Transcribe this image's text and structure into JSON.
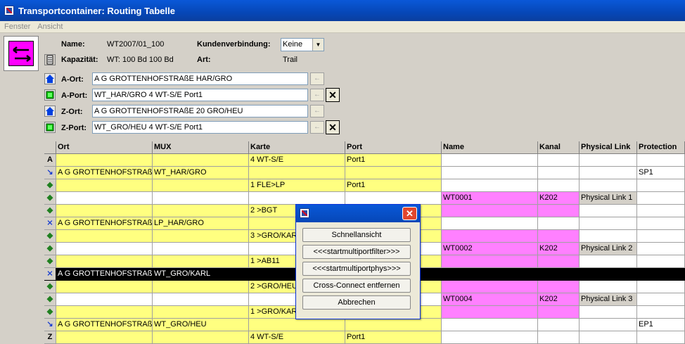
{
  "window": {
    "title": "Transportcontainer: Routing Tabelle"
  },
  "menu": [
    "Fenster",
    "Ansicht"
  ],
  "info": {
    "name_label": "Name:",
    "name_value": "WT2007/01_100",
    "kap_label": "Kapazität:",
    "kap_value": "WT: 100 Bd 100 Bd",
    "kunden_label": "Kundenverbindung:",
    "kunden_value": "Keine",
    "art_label": "Art:",
    "art_value": "Trail"
  },
  "endpoints": {
    "a_ort_label": "A-Ort:",
    "a_ort_value": "A G GROTTENHOFSTRAßE HAR/GRO",
    "a_port_label": "A-Port:",
    "a_port_value": "WT_HAR/GRO 4 WT-S/E Port1",
    "z_ort_label": "Z-Ort:",
    "z_ort_value": "A G GROTTENHOFSTRAßE 20 GRO/HEU",
    "z_port_label": "Z-Port:",
    "z_port_value": "WT_GRO/HEU 4 WT-S/E Port1",
    "arrow_glyph": "←",
    "close_glyph": "✕"
  },
  "table": {
    "headers": [
      "Ort",
      "MUX",
      "Karte",
      "Port",
      "Name",
      "Kanal",
      "Physical Link",
      "Protection"
    ],
    "rows": [
      {
        "mark": "A",
        "c": [
          "",
          "",
          "4 WT-S/E",
          "Port1",
          "",
          "",
          "",
          ""
        ],
        "colors": [
          "y",
          "y",
          "y",
          "y",
          "w",
          "w",
          "w",
          "w"
        ]
      },
      {
        "mark": "↘",
        "c": [
          "A G GROTTENHOFSTRAß",
          "WT_HAR/GRO",
          "",
          "",
          "",
          "",
          "",
          "SP1"
        ],
        "colors": [
          "y",
          "y",
          "y",
          "y",
          "w",
          "w",
          "w",
          "w"
        ]
      },
      {
        "mark": "◆",
        "c": [
          "",
          "",
          "1 FLE>LP",
          "Port1",
          "",
          "",
          "",
          ""
        ],
        "colors": [
          "y",
          "y",
          "y",
          "y",
          "w",
          "w",
          "w",
          "w"
        ]
      },
      {
        "mark": "◆",
        "c": [
          "",
          "",
          "",
          "",
          "WT0001",
          "K202",
          "Physical Link 1",
          ""
        ],
        "colors": [
          "w",
          "w",
          "w",
          "w",
          "m",
          "m",
          "g",
          "w"
        ]
      },
      {
        "mark": "◆",
        "c": [
          "",
          "",
          "2 >BGT",
          "",
          "",
          "",
          "",
          ""
        ],
        "colors": [
          "y",
          "y",
          "y",
          "y",
          "m",
          "m",
          "w",
          "w"
        ]
      },
      {
        "mark": "⨯",
        "c": [
          "A G GROTTENHOFSTRAß",
          "LP_HAR/GRO",
          "",
          "",
          "",
          "",
          "",
          ""
        ],
        "colors": [
          "y",
          "y",
          "y",
          "y",
          "w",
          "w",
          "w",
          "w"
        ]
      },
      {
        "mark": "◆",
        "c": [
          "",
          "",
          "3 >GRO/KAR",
          "",
          "",
          "",
          "",
          ""
        ],
        "colors": [
          "y",
          "y",
          "y",
          "y",
          "m",
          "m",
          "w",
          "w"
        ]
      },
      {
        "mark": "◆",
        "c": [
          "",
          "",
          "",
          "",
          "WT0002",
          "K202",
          "Physical Link 2",
          ""
        ],
        "colors": [
          "w",
          "w",
          "w",
          "w",
          "m",
          "m",
          "g",
          "w"
        ]
      },
      {
        "mark": "◆",
        "c": [
          "",
          "",
          "1 >AB11",
          "",
          "",
          "",
          "",
          ""
        ],
        "colors": [
          "y",
          "y",
          "y",
          "y",
          "m",
          "m",
          "w",
          "w"
        ]
      },
      {
        "mark": "⨯",
        "c": [
          "A G GROTTENHOFSTRAß",
          "WT_GRO/KARL",
          "",
          "",
          "",
          "",
          "",
          ""
        ],
        "colors": [
          "k",
          "k",
          "k",
          "k",
          "k",
          "k",
          "k",
          "k"
        ]
      },
      {
        "mark": "◆",
        "c": [
          "",
          "",
          "2 >GRO/HEU",
          "",
          "",
          "",
          "",
          ""
        ],
        "colors": [
          "y",
          "y",
          "y",
          "y",
          "m",
          "m",
          "w",
          "w"
        ]
      },
      {
        "mark": "◆",
        "c": [
          "",
          "",
          "",
          "",
          "WT0004",
          "K202",
          "Physical Link 3",
          ""
        ],
        "colors": [
          "w",
          "w",
          "w",
          "w",
          "m",
          "m",
          "g",
          "w"
        ]
      },
      {
        "mark": "◆",
        "c": [
          "",
          "",
          "1 >GRO/KAR",
          "",
          "",
          "",
          "",
          ""
        ],
        "colors": [
          "y",
          "y",
          "y",
          "y",
          "m",
          "m",
          "w",
          "w"
        ]
      },
      {
        "mark": "↘",
        "c": [
          "A G GROTTENHOFSTRAß",
          "WT_GRO/HEU",
          "",
          "",
          "",
          "",
          "",
          "EP1"
        ],
        "colors": [
          "y",
          "y",
          "y",
          "y",
          "w",
          "w",
          "w",
          "w"
        ]
      },
      {
        "mark": "Z",
        "c": [
          "",
          "",
          "4 WT-S/E",
          "Port1",
          "",
          "",
          "",
          ""
        ],
        "colors": [
          "y",
          "y",
          "y",
          "y",
          "w",
          "w",
          "w",
          "w"
        ]
      }
    ]
  },
  "dialog": {
    "buttons": [
      "Schnellansicht",
      "<<<startmultiportfilter>>>",
      "<<<startmultiportphys>>>",
      "Cross-Connect entfernen",
      "Abbrechen"
    ],
    "close_glyph": "✕"
  },
  "colors": {
    "yellow": "#ffff80",
    "magenta": "#ff80ff",
    "title_blue": "#0a58d8",
    "icon_magenta": "#ff00ff"
  }
}
